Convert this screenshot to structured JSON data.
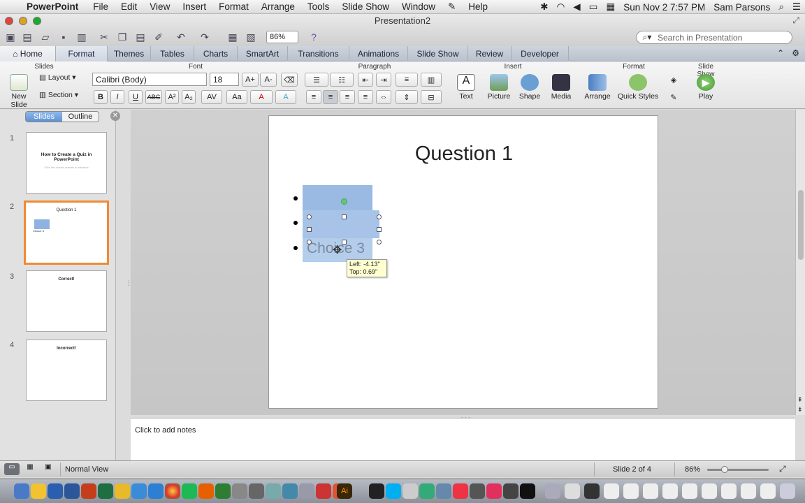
{
  "menubar": {
    "app_name": "PowerPoint",
    "items": [
      "File",
      "Edit",
      "View",
      "Insert",
      "Format",
      "Arrange",
      "Tools",
      "Slide Show",
      "Window",
      "Help"
    ],
    "clock": "Sun Nov 2  7:57 PM",
    "user": "Sam Parsons"
  },
  "window": {
    "title": "Presentation2",
    "zoom_value": "86%",
    "search_placeholder": "Search in Presentation"
  },
  "ribbon_tabs": [
    "Home",
    "Format",
    "Themes",
    "Tables",
    "Charts",
    "SmartArt",
    "Transitions",
    "Animations",
    "Slide Show",
    "Review",
    "Developer"
  ],
  "ribbon": {
    "groups": {
      "slides": "Slides",
      "font": "Font",
      "paragraph": "Paragraph",
      "insert": "Insert",
      "format": "Format",
      "slideshow": "Slide Show"
    },
    "new_slide": "New Slide",
    "layout": "Layout",
    "section": "Section",
    "font_name": "Calibri (Body)",
    "font_size": "18",
    "insert_buttons": [
      "Text",
      "Picture",
      "Shape",
      "Media"
    ],
    "arrange": "Arrange",
    "quick_styles": "Quick Styles",
    "play": "Play"
  },
  "panel": {
    "seg_slides": "Slides",
    "seg_outline": "Outline",
    "thumbnails": [
      {
        "num": "1",
        "title": "How to Create a Quiz in PowerPoint",
        "subtitle": "Click the correct answer to advance"
      },
      {
        "num": "2",
        "title": "Question 1",
        "subtitle": "Choice 3"
      },
      {
        "num": "3",
        "title": "Correct!",
        "subtitle": ""
      },
      {
        "num": "4",
        "title": "Incorrect!",
        "subtitle": ""
      }
    ]
  },
  "slide": {
    "title": "Question 1",
    "choice3": "Choice 3",
    "tooltip_left": "Left: -4.13\"",
    "tooltip_top": "Top: 0.69\""
  },
  "notes": {
    "placeholder": "Click to add notes"
  },
  "status": {
    "view": "Normal View",
    "slide_pos": "Slide 2 of 4",
    "zoom": "86%",
    "zoom_level": 0.25
  },
  "colors": {
    "selected_thumb_border": "#f08a37",
    "selection_fill": "#8fb3e0",
    "ribbon_tab_bar": "#b9c2cd"
  }
}
